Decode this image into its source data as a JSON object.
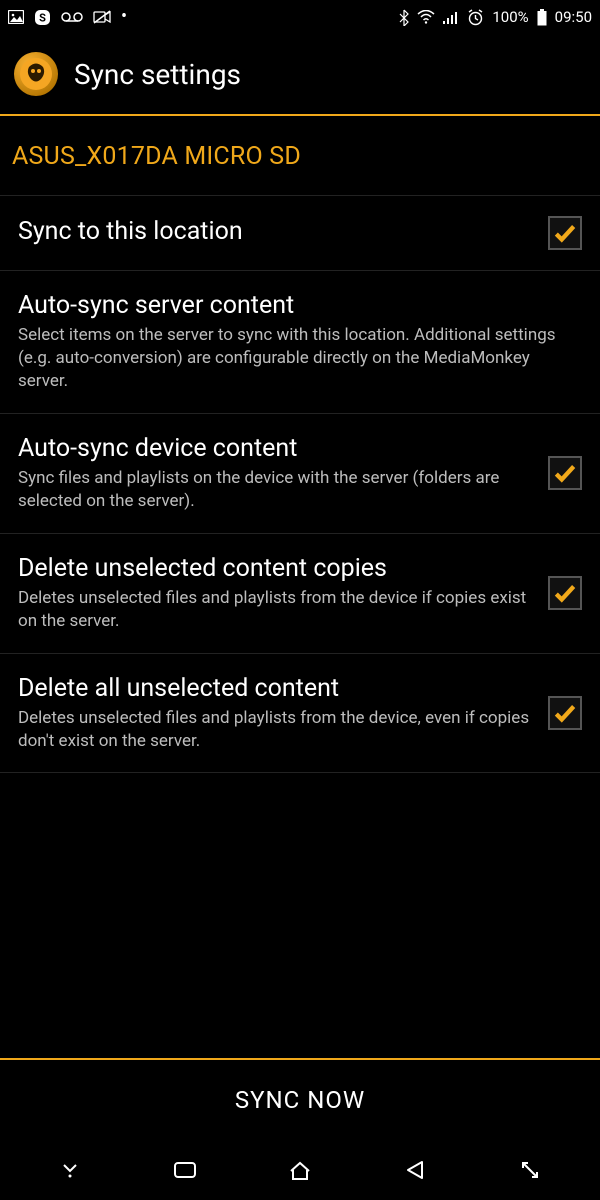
{
  "status": {
    "battery": "100%",
    "time": "09:50"
  },
  "header": {
    "title": "Sync settings"
  },
  "section": {
    "title": "ASUS_X017DA MICRO SD"
  },
  "settings": [
    {
      "title": "Sync to this location",
      "desc": "",
      "checked": true,
      "hasCheckbox": true
    },
    {
      "title": "Auto-sync server content",
      "desc": "Select items on the server to sync with this location. Additional settings (e.g. auto-conversion) are configurable directly on the MediaMonkey server.",
      "hasCheckbox": false
    },
    {
      "title": "Auto-sync device content",
      "desc": "Sync files and playlists on the device with the server (folders are selected on the server).",
      "checked": true,
      "hasCheckbox": true
    },
    {
      "title": "Delete unselected content copies",
      "desc": "Deletes unselected files and playlists from the device if copies exist on the server.",
      "checked": true,
      "hasCheckbox": true
    },
    {
      "title": "Delete all unselected content",
      "desc": "Deletes unselected files and playlists from the device, even if copies don't exist on the server.",
      "checked": true,
      "hasCheckbox": true
    }
  ],
  "footer": {
    "syncButton": "SYNC NOW"
  },
  "colors": {
    "accent": "#f0a81a"
  }
}
